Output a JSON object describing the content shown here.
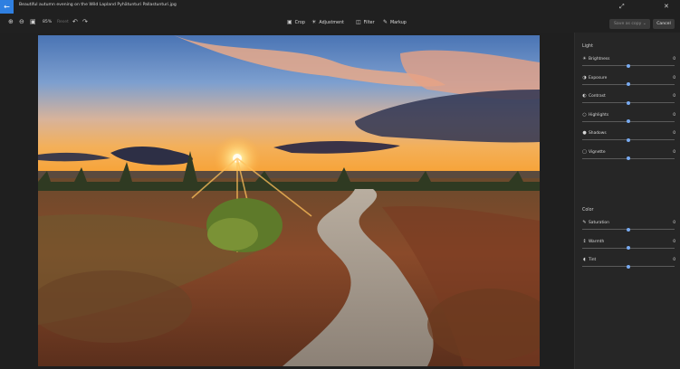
{
  "window": {
    "title": "Beautiful autumn evening on the Wild Lapland Pyhätunturi Pallastunturi.jpg",
    "back_icon": "back-arrow-icon"
  },
  "toolbar": {
    "zoom_level": "85%",
    "reset_label": "Reset",
    "tabs": [
      {
        "label": "Crop",
        "icon": "crop-icon"
      },
      {
        "label": "Adjustment",
        "icon": "adjustment-icon"
      },
      {
        "label": "Filter",
        "icon": "filter-icon"
      },
      {
        "label": "Markup",
        "icon": "markup-icon"
      }
    ],
    "active_tab": "Adjustment",
    "save_label": "Save as copy",
    "cancel_label": "Cancel"
  },
  "panel": {
    "light": {
      "title": "Light",
      "items": [
        {
          "label": "Brightness",
          "value": "0",
          "icon": "brightness-icon",
          "level": 0.5
        },
        {
          "label": "Exposure",
          "value": "0",
          "icon": "exposure-icon",
          "level": 0.5
        },
        {
          "label": "Contrast",
          "value": "0",
          "icon": "contrast-icon",
          "level": 0.5
        },
        {
          "label": "Highlights",
          "value": "0",
          "icon": "highlights-icon",
          "level": 0.5
        },
        {
          "label": "Shadows",
          "value": "0",
          "icon": "shadows-icon",
          "level": 0.5
        },
        {
          "label": "Vignette",
          "value": "0",
          "icon": "vignette-icon",
          "level": 0.5
        }
      ]
    },
    "color": {
      "title": "Color",
      "items": [
        {
          "label": "Saturation",
          "value": "0",
          "icon": "saturation-icon",
          "level": 0.5
        },
        {
          "label": "Warmth",
          "value": "0",
          "icon": "warmth-icon",
          "level": 0.5
        },
        {
          "label": "Tint",
          "value": "0",
          "icon": "tint-icon",
          "level": 0.5
        }
      ]
    }
  },
  "colors": {
    "accent": "#78aaf0",
    "back_button": "#2f7fe0",
    "panel_bg": "#262626",
    "app_bg": "#1c1c1c"
  }
}
